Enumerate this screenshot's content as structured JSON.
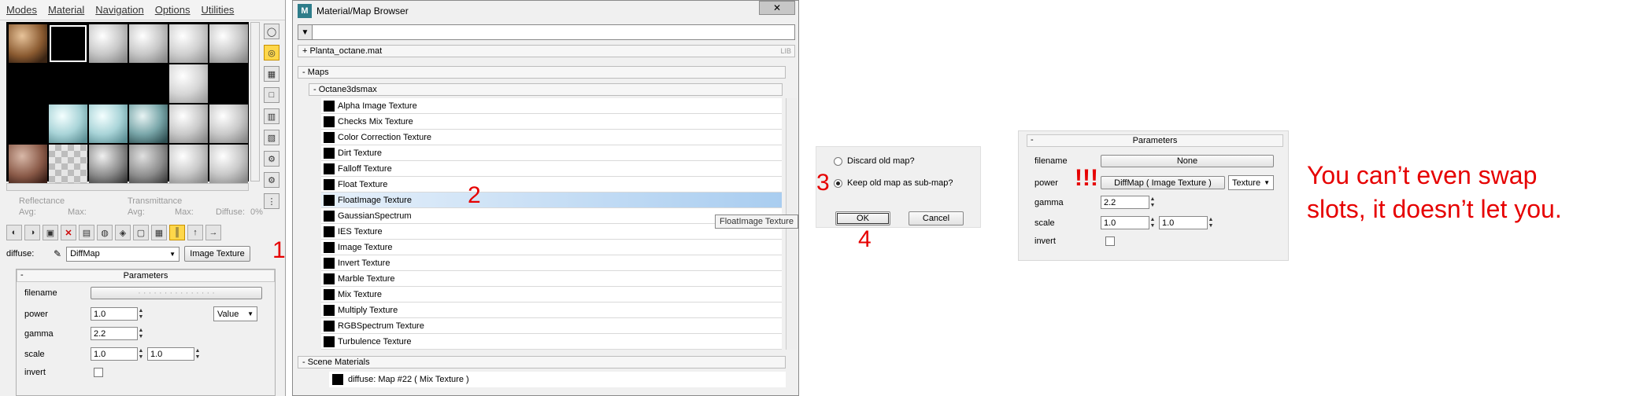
{
  "material_editor": {
    "menu": [
      "Modes",
      "Material",
      "Navigation",
      "Options",
      "Utilities"
    ],
    "reflectance_label": "Reflectance",
    "transmittance_label": "Transmittance",
    "avg_label_1": "Avg:",
    "max_label_1": "Max:",
    "avg_label_2": "Avg:",
    "max_label_2": "Max:",
    "diffuse_stat_label": "Diffuse:",
    "diffuse_stat_value": "0%",
    "diffuse_label": "diffuse:",
    "map_name": "DiffMap",
    "map_type_button": "Image Texture",
    "params": {
      "title": "Parameters",
      "collapse": "-",
      "filename_label": "filename",
      "power_label": "power",
      "power_value": "1.0",
      "power_mode": "Value",
      "gamma_label": "gamma",
      "gamma_value": "2.2",
      "scale_label": "scale",
      "scale_x": "1.0",
      "scale_y": "1.0",
      "invert_label": "invert"
    }
  },
  "browser": {
    "title": "Material/Map Browser",
    "close_icon": "close-icon",
    "library": "+ Planta_octane.mat",
    "library_tag": "LIB",
    "maps_group": "- Maps",
    "octane_group": "- Octane3dsmax",
    "maps": [
      "Alpha Image Texture",
      "Checks Mix Texture",
      "Color Correction Texture",
      "Dirt Texture",
      "Falloff Texture",
      "Float Texture",
      "FloatImage Texture",
      "GaussianSpectrum",
      "IES Texture",
      "Image Texture",
      "Invert Texture",
      "Marble Texture",
      "Mix Texture",
      "Multiply Texture",
      "RGBSpectrum Texture",
      "Turbulence Texture"
    ],
    "selected_index": 6,
    "tooltip": "FloatImage Texture",
    "scene_group": "- Scene Materials",
    "scene_item": "diffuse: Map #22  ( Mix Texture )"
  },
  "dialog": {
    "option_discard": "Discard old map?",
    "option_keep": "Keep old map as sub-map?",
    "selected": "keep",
    "ok": "OK",
    "cancel": "Cancel"
  },
  "params_panel": {
    "title": "Parameters",
    "collapse": "-",
    "filename_label": "filename",
    "filename_value": "None",
    "power_label": "power",
    "power_map": "DiffMap  ( Image Texture )",
    "power_mode": "Texture",
    "gamma_label": "gamma",
    "gamma_value": "2.2",
    "scale_label": "scale",
    "scale_x": "1.0",
    "scale_y": "1.0",
    "invert_label": "invert"
  },
  "annotations": {
    "n1": "1",
    "n2": "2",
    "n3": "3",
    "n4": "4",
    "alert": "!!!",
    "comment_line1": "You can’t even swap",
    "comment_line2": "slots, it doesn’t let you.",
    "color": "#e60000"
  },
  "colors": {
    "selection": "#a9cdf0",
    "active_tool": "#ffd74a"
  }
}
